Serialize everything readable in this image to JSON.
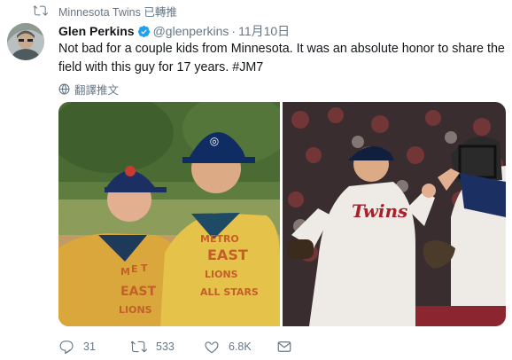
{
  "retweet_context": {
    "text": "Minnesota Twins 已轉推",
    "icon": "retweet-icon"
  },
  "author": {
    "name": "Glen Perkins",
    "handle": "@glenperkins",
    "separator": "·",
    "time": "11月10日",
    "verified": true
  },
  "tweet": {
    "text_lines": [
      "Not bad for a couple kids from Minnesota. It was an absolute honor to share the",
      "field with this guy for 17 years. #JM7"
    ]
  },
  "translate": {
    "label": "翻譯推文",
    "icon": "globe-icon"
  },
  "media": {
    "jersey_text_right": "Twins"
  },
  "actions": {
    "reply_count": "31",
    "retweet_count": "533",
    "like_count": "6.8K"
  },
  "colors": {
    "text_primary": "#14171a",
    "text_secondary": "#657786",
    "verified_blue": "#1da1f2"
  }
}
